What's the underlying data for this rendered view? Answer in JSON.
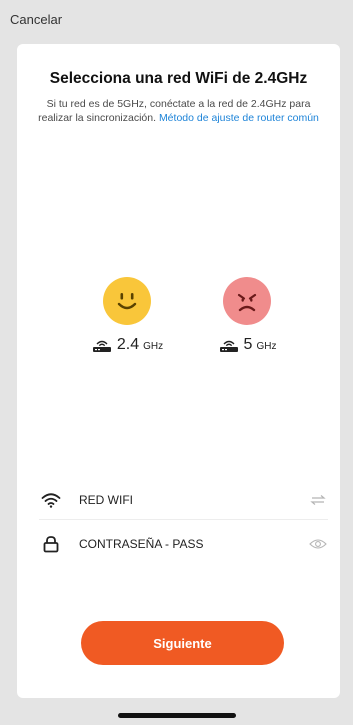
{
  "header": {
    "cancel_label": "Cancelar"
  },
  "title": "Selecciona una red WiFi de 2.4GHz",
  "subtitle": {
    "text": "Si tu red es de 5GHz, conéctate a la red de 2.4GHz para realizar la sincronización. ",
    "link": "Método de ajuste de router común"
  },
  "bands": [
    {
      "icon": "happy-face-icon",
      "number": "2.4",
      "unit": "GHz",
      "color": "#f9c63a"
    },
    {
      "icon": "sad-face-icon",
      "number": "5",
      "unit": "GHz",
      "color": "#f08c8c"
    }
  ],
  "form": {
    "wifi_label": "RED WIFI",
    "password_label": "CONTRASEÑA - PASS"
  },
  "next_button": {
    "label": "Siguiente",
    "color": "#f05a23"
  },
  "link_color": "#1e84d8"
}
